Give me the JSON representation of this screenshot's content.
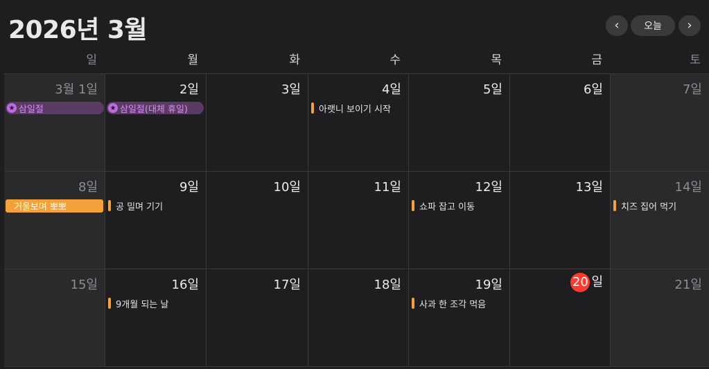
{
  "header": {
    "title": "2026년 3월",
    "prev_icon": "‹",
    "next_icon": "›",
    "today_label": "오늘"
  },
  "weekdays": [
    "일",
    "월",
    "화",
    "수",
    "목",
    "금",
    "토"
  ],
  "weeks": [
    [
      {
        "day": "3월 1일",
        "event": "삼일절",
        "event_type": "holiday"
      },
      {
        "day": "2일",
        "event": "삼일절(대체 휴일)",
        "event_type": "holiday"
      },
      {
        "day": "3일"
      },
      {
        "day": "4일",
        "event": "아랫니 보이기 시작",
        "event_type": "timed"
      },
      {
        "day": "5일"
      },
      {
        "day": "6일"
      },
      {
        "day": "7일"
      }
    ],
    [
      {
        "day": "8일",
        "event": "거울보며 뽀뽀",
        "event_type": "allday"
      },
      {
        "day": "9일",
        "event": "공 밀며 기기",
        "event_type": "timed"
      },
      {
        "day": "10일"
      },
      {
        "day": "11일"
      },
      {
        "day": "12일",
        "event": "쇼파 잡고 이동",
        "event_type": "timed"
      },
      {
        "day": "13일"
      },
      {
        "day": "14일",
        "event": "치즈 집어 먹기",
        "event_type": "timed"
      }
    ],
    [
      {
        "day": "15일"
      },
      {
        "day": "16일",
        "event": "9개월 되는 날",
        "event_type": "timed"
      },
      {
        "day": "17일"
      },
      {
        "day": "18일"
      },
      {
        "day": "19일",
        "event": "사과 한 조각 먹음",
        "event_type": "timed"
      },
      {
        "day": "20",
        "day_suffix": "일",
        "today": true
      },
      {
        "day": "21일"
      }
    ]
  ],
  "colors": {
    "accent_orange": "#f5a13b",
    "holiday_purple": "#c06ce0",
    "today_red": "#ff3b30"
  }
}
